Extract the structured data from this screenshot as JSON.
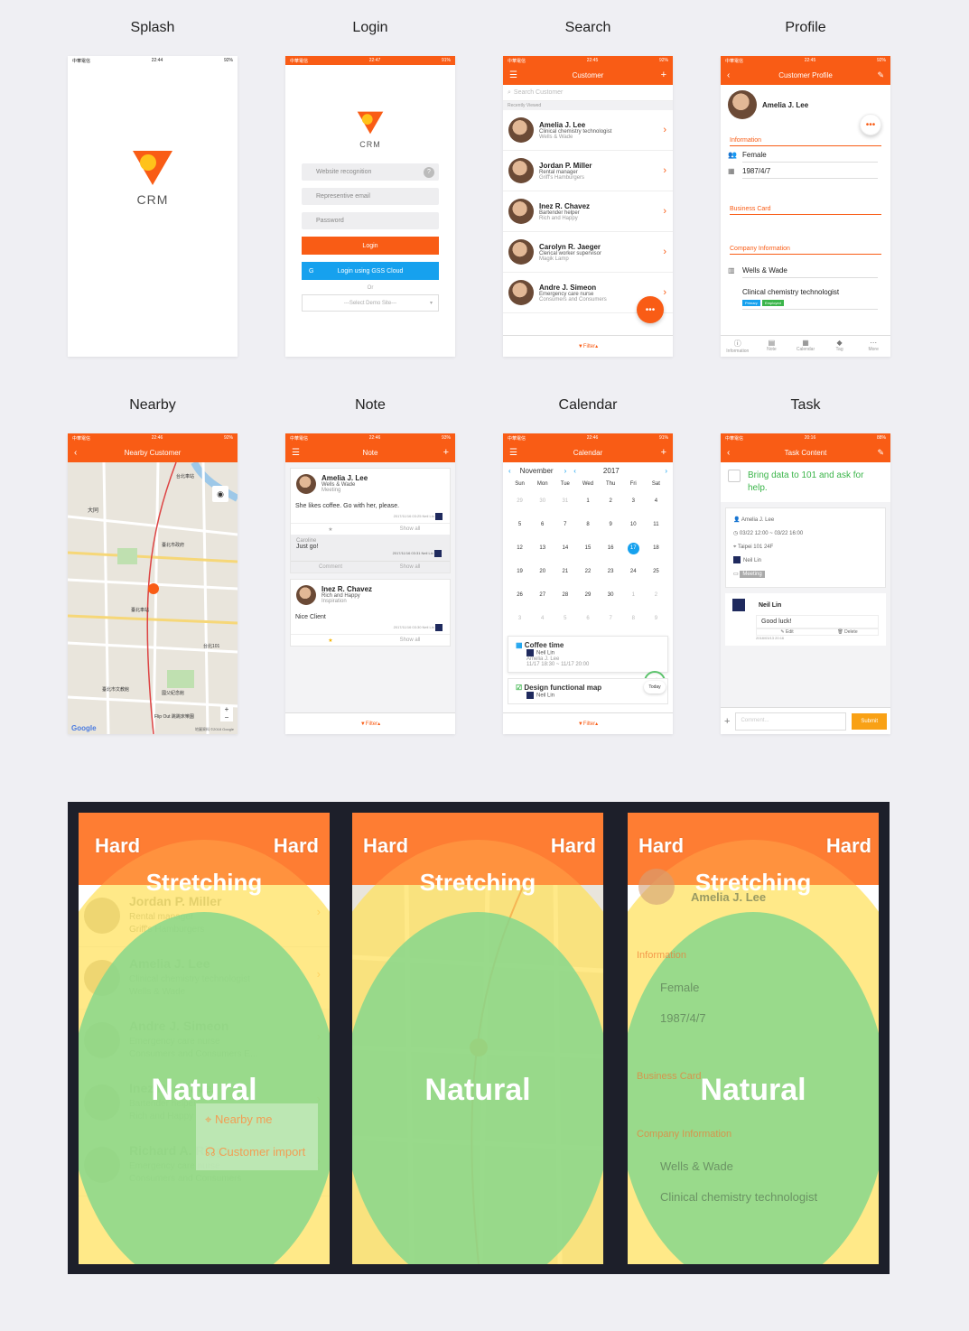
{
  "screens": {
    "splash": {
      "title": "Splash",
      "status": {
        "carrier": "中華電信",
        "time": "22:44",
        "battery": "92%"
      },
      "brand": "CRM"
    },
    "login": {
      "title": "Login",
      "status": {
        "carrier": "中華電信",
        "time": "22:47",
        "battery": "91%"
      },
      "brand": "CRM",
      "website_placeholder": "Website recognition",
      "email_placeholder": "Representive email",
      "password_placeholder": "Password",
      "login_label": "Login",
      "gss_label": "Login using GSS Cloud",
      "gss_badge": "G",
      "or": "Or",
      "demo_select": "---Select Demo Site---"
    },
    "search": {
      "title": "Search",
      "status": {
        "carrier": "中華電信",
        "time": "22:45",
        "battery": "92%"
      },
      "header": "Customer",
      "search_placeholder": "Search Customer",
      "section": "Recently Viewed",
      "customers": [
        {
          "name": "Amelia J. Lee",
          "role": "Clinical chemistry technologist",
          "company": "Wells & Wade"
        },
        {
          "name": "Jordan P. Miller",
          "role": "Rental manager",
          "company": "Griff's Hamburgers"
        },
        {
          "name": "Inez R. Chavez",
          "role": "Bartender helper",
          "company": "Rich and Happy"
        },
        {
          "name": "Carolyn R. Jaeger",
          "role": "Clerical worker supervisor",
          "company": "Magik Lamp"
        },
        {
          "name": "Andre J. Simeon",
          "role": "Emergency care nurse",
          "company": "Consumers and Consumers"
        }
      ],
      "fab": "•••",
      "filter": "Filter"
    },
    "profile": {
      "title": "Profile",
      "status": {
        "carrier": "中華電信",
        "time": "22:45",
        "battery": "92%"
      },
      "header": "Customer Profile",
      "name": "Amelia J. Lee",
      "more": "•••",
      "info_section": "Information",
      "gender": "Female",
      "birthday": "1987/4/7",
      "card_section": "Business Card",
      "company_section": "Company Information",
      "company": "Wells & Wade",
      "job": "Clinical chemistry technologist",
      "tag_primary": "Primary",
      "tag_employed": "Employed",
      "tabs": [
        "Information",
        "Note",
        "Calendar",
        "Tag",
        "More"
      ]
    },
    "nearby": {
      "title": "Nearby",
      "status": {
        "carrier": "中華電信",
        "time": "22:46",
        "battery": "92%"
      },
      "header": "Nearby Customer",
      "map_labels": [
        "台北車站",
        "大同",
        "臺北市政府",
        "國父紀念館",
        "Flip Out 跳跳床樂園",
        "臺北市文教館",
        "台北101",
        "臺北車站"
      ],
      "google": "Google",
      "footer": "地圖資料 ©2018 Google",
      "zoom_in": "+",
      "zoom_out": "−"
    },
    "note": {
      "title": "Note",
      "status": {
        "carrier": "中華電信",
        "time": "22:46",
        "battery": "93%"
      },
      "header": "Note",
      "notes": [
        {
          "name": "Amelia J. Lee",
          "company": "Wells & Wade",
          "type": "Meeting",
          "body": "She likes coffee. Go with her, please.",
          "meta": "2017/11/16 03:25 Neil Lin"
        },
        {
          "name": "Inez R. Chavez",
          "company": "Rich and Happy",
          "type": "Inspiration",
          "body": "Nice Client",
          "meta": "2017/11/16 03:30 Neil Lin"
        }
      ],
      "reply": {
        "author": "Caroline",
        "body": "Just go!",
        "meta": "2017/11/16 03:31 Neil Lin"
      },
      "show_all": "Show all",
      "comment": "Comment",
      "filter": "Filter"
    },
    "calendar": {
      "title": "Calendar",
      "status": {
        "carrier": "中華電信",
        "time": "22:46",
        "battery": "91%"
      },
      "header": "Calendar",
      "month": "November",
      "year": "2017",
      "weekdays": [
        "Sun",
        "Mon",
        "Tue",
        "Wed",
        "Thu",
        "Fri",
        "Sat"
      ],
      "days": [
        "29",
        "30",
        "31",
        "1",
        "2",
        "3",
        "4",
        "5",
        "6",
        "7",
        "8",
        "9",
        "10",
        "11",
        "12",
        "13",
        "14",
        "15",
        "16",
        "17",
        "18",
        "19",
        "20",
        "21",
        "22",
        "23",
        "24",
        "25",
        "26",
        "27",
        "28",
        "29",
        "30",
        "1",
        "2",
        "3",
        "4",
        "5",
        "6",
        "7",
        "8",
        "9"
      ],
      "events": [
        {
          "title": "Coffee time",
          "owner": "Neil Lin",
          "client": "Amelia J. Lee",
          "time": "11/17 18:30 ~ 11/17 20:00"
        },
        {
          "title": "Design functional map",
          "owner": "Neil Lin"
        }
      ],
      "done": "Done",
      "today": "Today",
      "filter": "Filter"
    },
    "task": {
      "title": "Task",
      "status": {
        "carrier": "中華電信",
        "time": "20:16",
        "battery": "88%"
      },
      "header": "Task Content",
      "task_title": "Bring data to 101 and ask for help.",
      "client": "Amelia J. Lee",
      "time": "03/22 12:00 ~ 03/22 16:00",
      "place": "Taipei 101 24F",
      "owner": "Neil Lin",
      "tag": "Meeting",
      "comment_author": "Neil Lin",
      "comment": "Good luck!",
      "edit": "Edit",
      "delete": "Delete",
      "comment_time": "2018/03/13 20:16",
      "comment_placeholder": "Comment...",
      "submit": "Submit"
    }
  },
  "heatmaps": {
    "hard": "Hard",
    "stretching": "Stretching",
    "natural": "Natural",
    "search_rows": [
      {
        "name": "Jordan P. Miller",
        "role": "Rental manager",
        "company": "Griff's Hamburgers"
      },
      {
        "name": "Amelia J. Lee",
        "role": "Clinical chemistry technologist",
        "company": "Wells & Wade"
      },
      {
        "name": "Andre J. Simeon",
        "role": "Emergency care nurse",
        "company": "Consumers and Consumers E..."
      },
      {
        "name": "Inez R. Chavez",
        "role": "Bartender helper",
        "company": "Rich and Happy"
      },
      {
        "name": "Richard A. Riggs",
        "role": "Emergency care nurse",
        "company": "Consumers and Consumers"
      }
    ],
    "popup": [
      "Nearby me",
      "Customer import"
    ],
    "profile_items": [
      "Information",
      "Female",
      "1987/4/7",
      "Business Card",
      "Company Information",
      "Wells & Wade",
      "Clinical chemistry technologist"
    ],
    "colors": {
      "hard": "#ff8a3c",
      "stretch": "#ffe05a",
      "natural": "#82d78c"
    }
  }
}
